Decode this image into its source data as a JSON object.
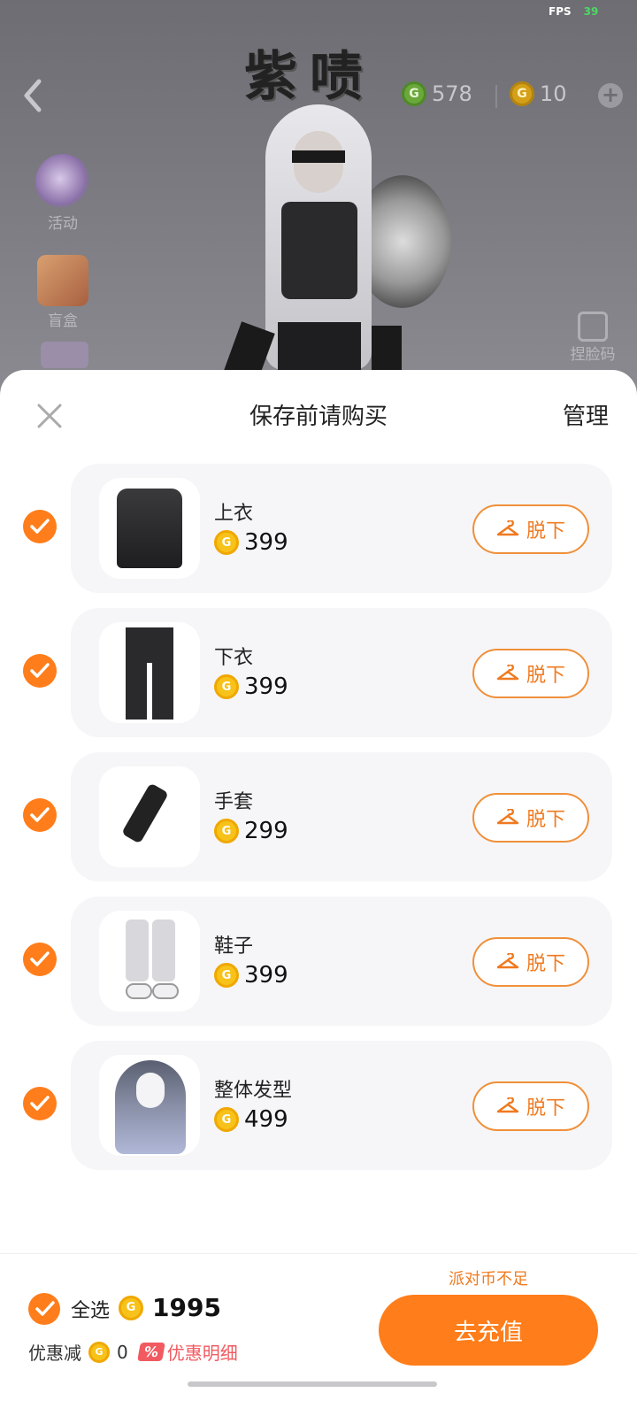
{
  "status": {
    "fps_label": "FPS",
    "fps_value": "39"
  },
  "header": {
    "title_art": "紫啧",
    "green_coins": "578",
    "gold_coins": "10"
  },
  "side": {
    "activity_label": "活动",
    "blindbox_label": "盲盒",
    "pinch_label": "捏脸码"
  },
  "sheet": {
    "title": "保存前请购买",
    "manage_label": "管理",
    "take_off_label": "脱下",
    "items": [
      {
        "name": "上衣",
        "price": "399",
        "checked": true
      },
      {
        "name": "下衣",
        "price": "399",
        "checked": true
      },
      {
        "name": "手套",
        "price": "299",
        "checked": true
      },
      {
        "name": "鞋子",
        "price": "399",
        "checked": true
      },
      {
        "name": "整体发型",
        "price": "499",
        "checked": true
      }
    ]
  },
  "footer": {
    "insufficient": "派对币不足",
    "select_all_label": "全选",
    "total": "1995",
    "discount_label": "优惠减",
    "discount_value": "0",
    "discount_badge": "%",
    "discount_detail": "优惠明细",
    "recharge_label": "去充值"
  },
  "colors": {
    "accent": "#ff7d1a",
    "coin_gold": "#f7c21a",
    "coin_green": "#6aa83a",
    "discount_red": "#f05a60"
  },
  "icons": [
    "back-arrow-icon",
    "green-coin-icon",
    "gold-coin-icon",
    "plus-icon",
    "close-icon",
    "hanger-icon",
    "check-icon",
    "coin-icon"
  ]
}
